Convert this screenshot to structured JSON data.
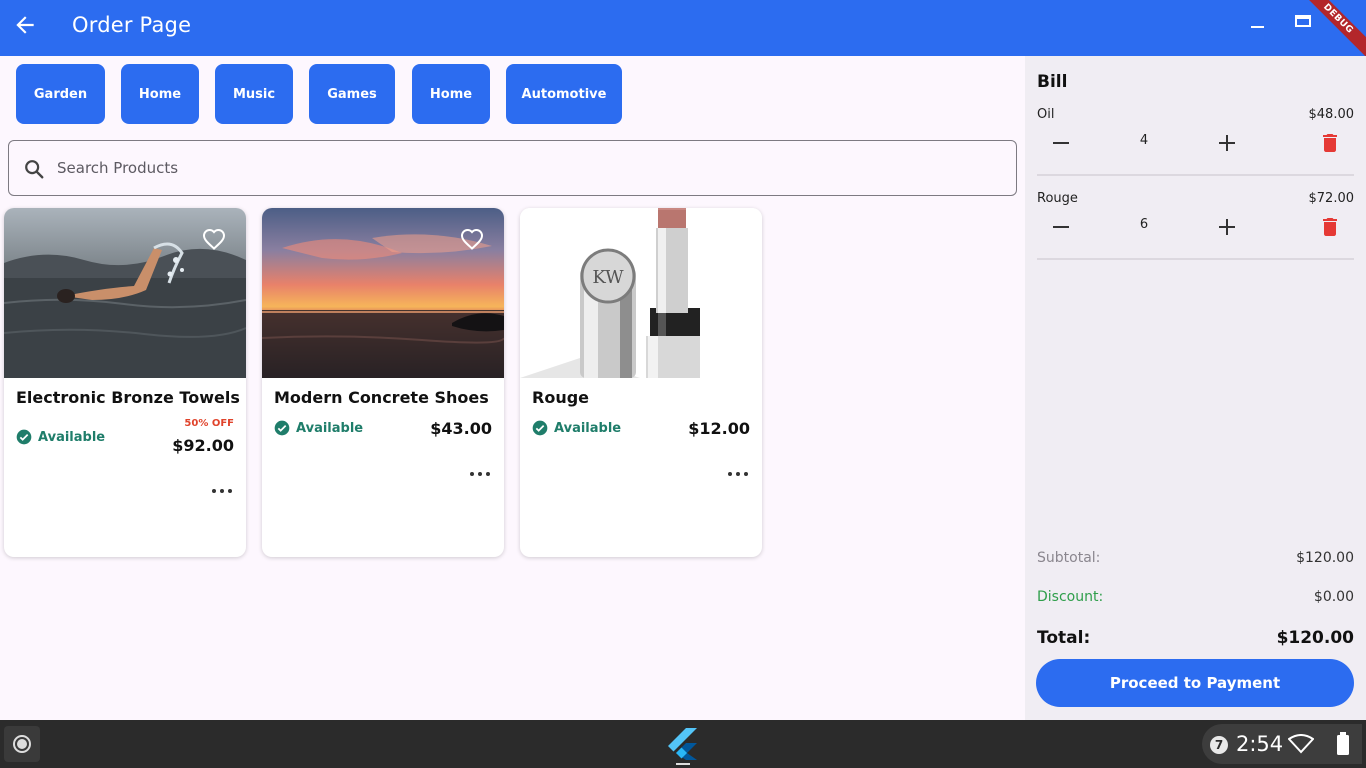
{
  "appbar": {
    "title": "Order Page",
    "debug_label": "DEBUG"
  },
  "categories": [
    "Garden",
    "Home",
    "Music",
    "Games",
    "Home",
    "Automotive"
  ],
  "search": {
    "placeholder": "Search Products",
    "value": ""
  },
  "products": [
    {
      "name": "Electronic Bronze Towels",
      "availability": "Available",
      "price": "$92.00",
      "discount": "50% OFF",
      "image": "swimmer-in-lake-photo"
    },
    {
      "name": "Modern Concrete Shoes",
      "availability": "Available",
      "price": "$43.00",
      "discount": "",
      "image": "sunset-over-water-photo"
    },
    {
      "name": "Rouge",
      "availability": "Available",
      "price": "$12.00",
      "discount": "",
      "image": "lipstick-product-photo"
    }
  ],
  "bill": {
    "title": "Bill",
    "items": [
      {
        "name": "Oil",
        "price": "$48.00",
        "qty": "4"
      },
      {
        "name": "Rouge",
        "price": "$72.00",
        "qty": "6"
      }
    ],
    "subtotal_label": "Subtotal:",
    "subtotal": "$120.00",
    "discount_label": "Discount:",
    "discount": "$0.00",
    "total_label": "Total:",
    "total": "$120.00",
    "pay_button": "Proceed to Payment"
  },
  "taskbar": {
    "notification_count": "7",
    "time": "2:54"
  },
  "colors": {
    "primary": "#2c6cf0",
    "available": "#1f7d6a",
    "discount_text": "#e0432b",
    "delete": "#e53935",
    "bill_discount": "#2e9e4a"
  }
}
